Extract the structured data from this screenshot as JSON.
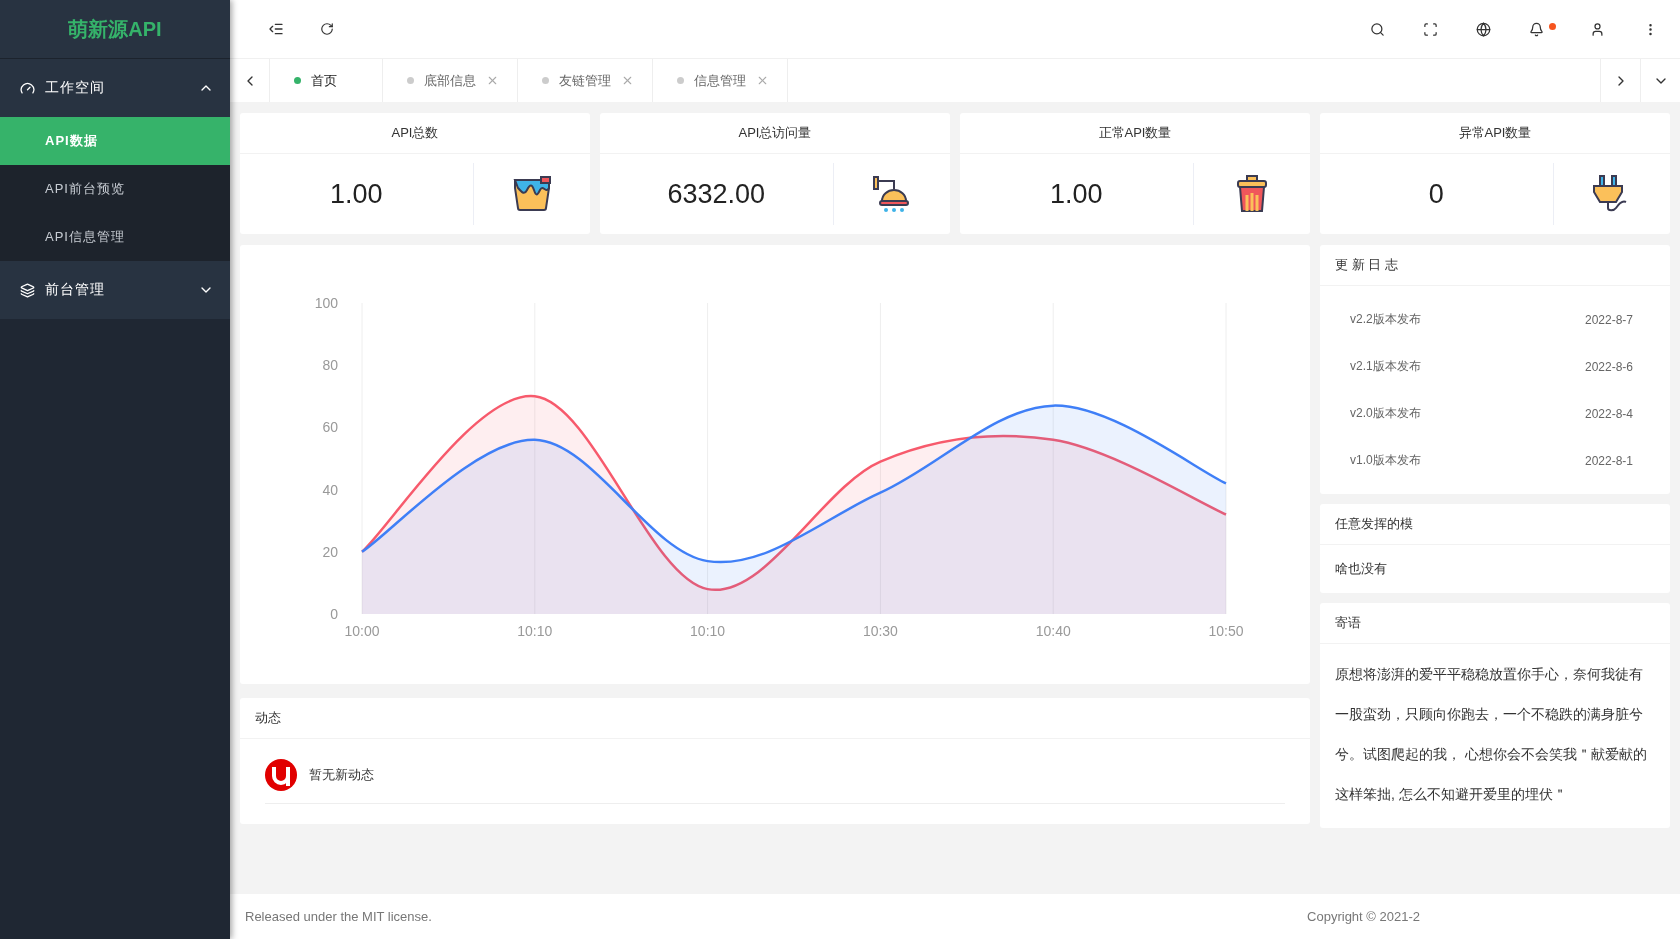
{
  "sidebar": {
    "logo": "萌新源API",
    "groups": [
      {
        "label": "工作空间",
        "expanded": true,
        "children": [
          {
            "label": "API数据",
            "selected": true
          },
          {
            "label": "API前台预览",
            "selected": false
          },
          {
            "label": "API信息管理",
            "selected": false
          }
        ]
      },
      {
        "label": "前台管理",
        "expanded": false
      }
    ]
  },
  "header": {
    "has_unread": true
  },
  "tabs": [
    {
      "label": "首页",
      "selected": true,
      "closable": false
    },
    {
      "label": "底部信息",
      "selected": false,
      "closable": true
    },
    {
      "label": "友链管理",
      "selected": false,
      "closable": true
    },
    {
      "label": "信息管理",
      "selected": false,
      "closable": true
    }
  ],
  "stats": [
    {
      "title": "API总数",
      "value": "1.00"
    },
    {
      "title": "API总访问量",
      "value": "6332.00"
    },
    {
      "title": "正常API数量",
      "value": "1.00"
    },
    {
      "title": "异常API数量",
      "value": "0"
    }
  ],
  "chart": {
    "chart_data": {
      "type": "area",
      "grid": true,
      "categories": [
        "10:00",
        "10:10",
        "10:10",
        "10:30",
        "10:40",
        "10:50"
      ],
      "ylim": [
        0,
        100
      ],
      "yticks": [
        0,
        20,
        40,
        60,
        80,
        100
      ],
      "series": [
        {
          "color": "#f75a6c",
          "values": [
            20,
            70,
            8,
            49,
            56,
            32
          ]
        },
        {
          "color": "#3f7ff7",
          "values": [
            20,
            56,
            17,
            39,
            67,
            42
          ]
        }
      ]
    }
  },
  "activity": {
    "title": "动态",
    "items": [
      {
        "text": "暂无新动态"
      }
    ]
  },
  "changelog": {
    "title": "更 新 日 志",
    "items": [
      {
        "label": "v2.2版本发布",
        "date": "2022-8-7"
      },
      {
        "label": "v2.1版本发布",
        "date": "2022-8-6"
      },
      {
        "label": "v2.0版本发布",
        "date": "2022-8-4"
      },
      {
        "label": "v1.0版本发布",
        "date": "2022-8-1"
      }
    ]
  },
  "custom": {
    "title": "任意发挥的模",
    "body": "啥也没有"
  },
  "message": {
    "title": "寄语",
    "body": "原想将澎湃的爱平平稳稳放置你手心，奈何我徒有一股蛮劲，只顾向你跑去，一个不稳跌的满身脏兮兮。试图爬起的我， 心想你会不会笑我＂献爱献的这样笨拙, 怎么不知避开爱里的埋伏＂"
  },
  "footer": {
    "left": "Released under the MIT license.",
    "right": "Copyright © 2021-2"
  }
}
